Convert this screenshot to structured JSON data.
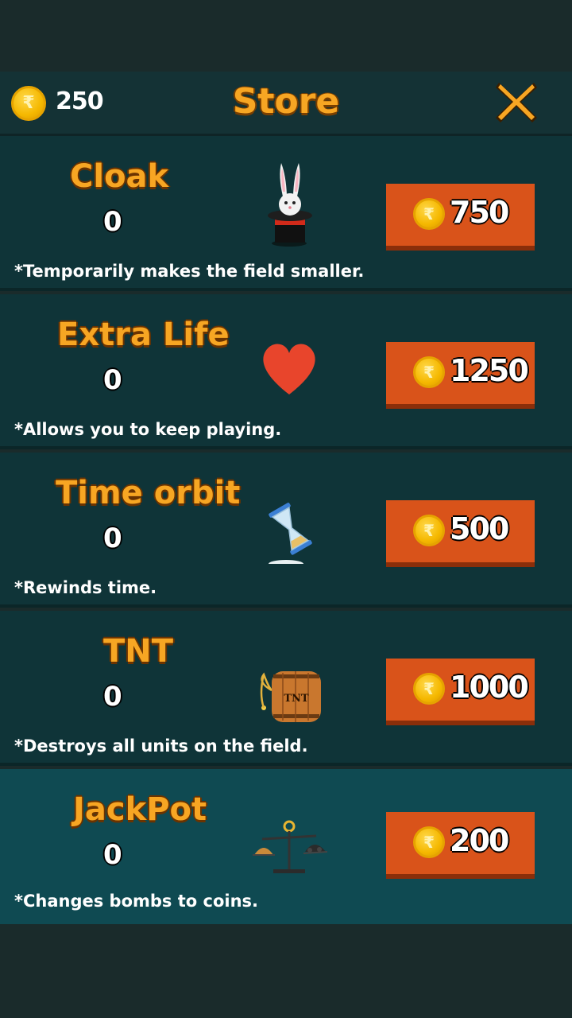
{
  "header": {
    "balance": "250",
    "coin_symbol": "₹",
    "title": "Store"
  },
  "items": [
    {
      "name": "Cloak",
      "count": "0",
      "description": "*Temporarily makes the field smaller.",
      "price": "750",
      "icon": "rabbit-hat-icon"
    },
    {
      "name": "Extra Life",
      "count": "0",
      "description": "*Allows you to keep playing.",
      "price": "1250",
      "icon": "heart-icon"
    },
    {
      "name": "Time orbit",
      "count": "0",
      "description": "*Rewinds time.",
      "price": "500",
      "icon": "hourglass-icon"
    },
    {
      "name": "TNT",
      "count": "0",
      "description": "*Destroys all units on the field.",
      "price": "1000",
      "icon": "tnt-barrel-icon",
      "icon_label": "TNT"
    },
    {
      "name": "JackPot",
      "count": "0",
      "description": "*Changes bombs to coins.",
      "price": "200",
      "icon": "balance-scale-icon"
    }
  ],
  "colors": {
    "accent": "#f7a623",
    "button": "#d9531a",
    "panel": "#0f3438",
    "panel_highlight": "#0f4a52"
  }
}
